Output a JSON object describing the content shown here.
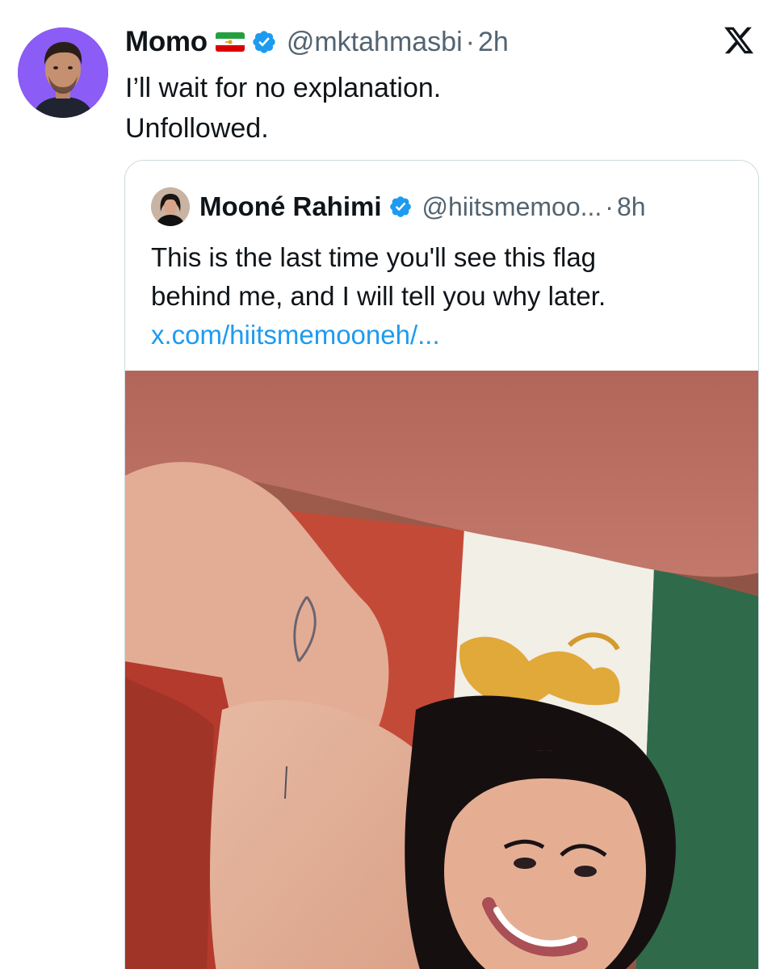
{
  "tweet": {
    "author_name": "Momo",
    "author_handle": "@mktahmasbi",
    "separator": "·",
    "time": "2h",
    "text_lines": [
      "I’ll wait for no explanation.",
      "Unfollowed."
    ],
    "avatar_bg": "#8b5cf6",
    "icons": {
      "avatar": "avatar-photo",
      "flag": "iran-lion-and-sun-flag-emoji",
      "verified": "verified-badge-icon",
      "brand": "x-logo-icon"
    }
  },
  "quote": {
    "author_name": "Mooné Rahimi",
    "author_handle": "@hiitsmemoo...",
    "separator": "·",
    "time": "8h",
    "text_lines": [
      "This is the last time you'll see this flag",
      "behind me, and I will tell you why later."
    ],
    "link": "x.com/hiitsmemooneh/...",
    "link_color": "#1d9bf0",
    "media": {
      "kind": "photo",
      "subject": "selfie-with-lion-and-sun-flag"
    }
  },
  "colors": {
    "text": "#0f1419",
    "muted": "#536471",
    "verified": "#1d9bf0",
    "border": "#cfd9de"
  }
}
